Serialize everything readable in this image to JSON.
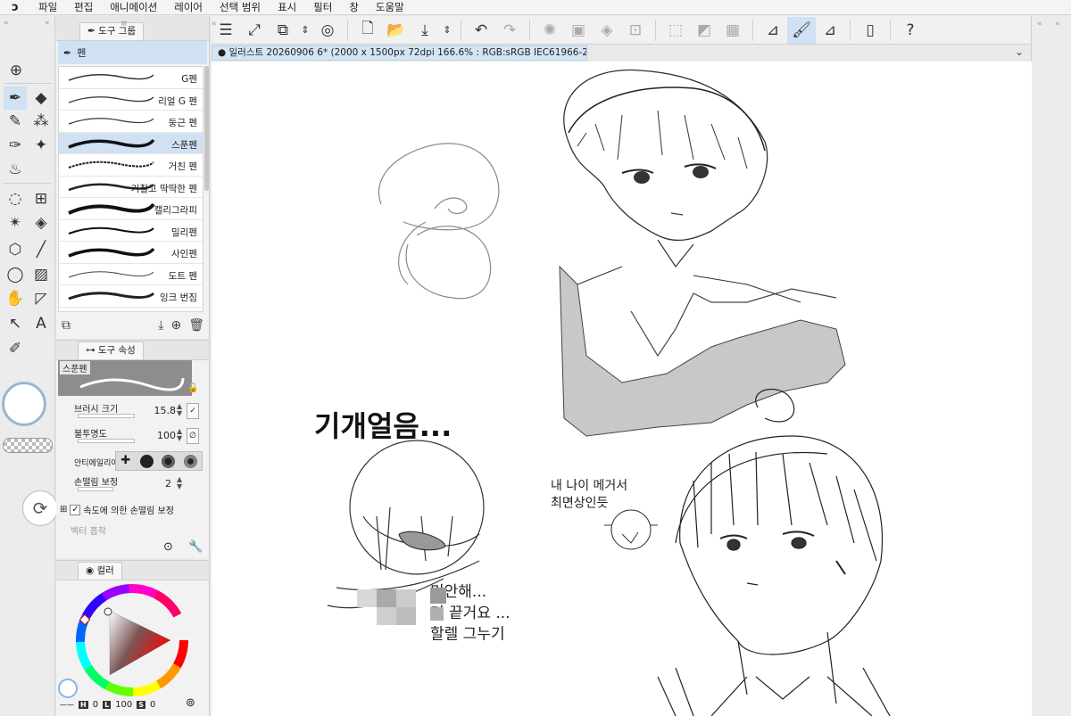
{
  "app": {
    "logo": "ↄ",
    "menu": [
      "파일",
      "편집",
      "애니메이션",
      "레이어",
      "선택 범위",
      "표시",
      "필터",
      "창",
      "도움말"
    ]
  },
  "toolbar": {
    "icons": [
      "menu-icon",
      "fit-screen-icon",
      "transform-icon",
      "stepper-icon",
      "lasso-icon",
      "new-file-icon",
      "open-folder-icon",
      "save-icon",
      "stepper-icon",
      "undo-icon",
      "redo-icon",
      "fill-dots-icon",
      "selection-icon",
      "paint-bucket-icon",
      "crop-icon",
      "deselect-icon",
      "invert-selection-icon",
      "grid-icon",
      "ruler-icon",
      "smoothing-brush-icon",
      "eraser-ruler-icon",
      "smartphone-icon",
      "help-icon"
    ]
  },
  "document": {
    "tab_label": "● 일러스트 20260906 6* (2000 x 1500px 72dpi 166.6% : RGB:sRGB IEC61966-2.1)"
  },
  "subtool_panel": {
    "tab_label": "도구 그룹",
    "group_label": "펜",
    "brushes": [
      {
        "name": "G펜",
        "selected": false
      },
      {
        "name": "리얼 G 펜",
        "selected": false
      },
      {
        "name": "둥근 펜",
        "selected": false
      },
      {
        "name": "스푼펜",
        "selected": true
      },
      {
        "name": "거친 펜",
        "selected": false
      },
      {
        "name": "거칠고 딱딱한 펜",
        "selected": false
      },
      {
        "name": "캘리그라피",
        "selected": false
      },
      {
        "name": "밀리펜",
        "selected": false
      },
      {
        "name": "사인펜",
        "selected": false
      },
      {
        "name": "도트 펜",
        "selected": false
      },
      {
        "name": "잉크 번짐",
        "selected": false
      }
    ]
  },
  "tool_property": {
    "tab_label": "도구 속성",
    "brush_title": "스푼펜",
    "brush_size_label": "브러시 크기",
    "brush_size_value": "15.8",
    "opacity_label": "불투명도",
    "opacity_value": "100",
    "antialias_label": "안티에일리어",
    "stabilization_label": "손떨림 보정",
    "stabilization_value": "2",
    "speed_stab_label": "속도에 의한 손떨림 보정",
    "vector_label": "벡터 흡착"
  },
  "color_panel": {
    "tab_label": "컬러",
    "h_value": "0",
    "l_value": "100",
    "s_value": "0",
    "h_label": "H",
    "l_label": "L",
    "s_label": "S"
  },
  "canvas": {
    "sketch_text_top": "기개얼음...",
    "note_text": "내 나이 메거서\n최면상인듯",
    "bottom_text": "미안해...\n거 끝거요 ...\n할렐 그누기"
  },
  "colors": {
    "selection_blue": "#cfe1f2",
    "accent_blue": "#8bb4e0"
  }
}
